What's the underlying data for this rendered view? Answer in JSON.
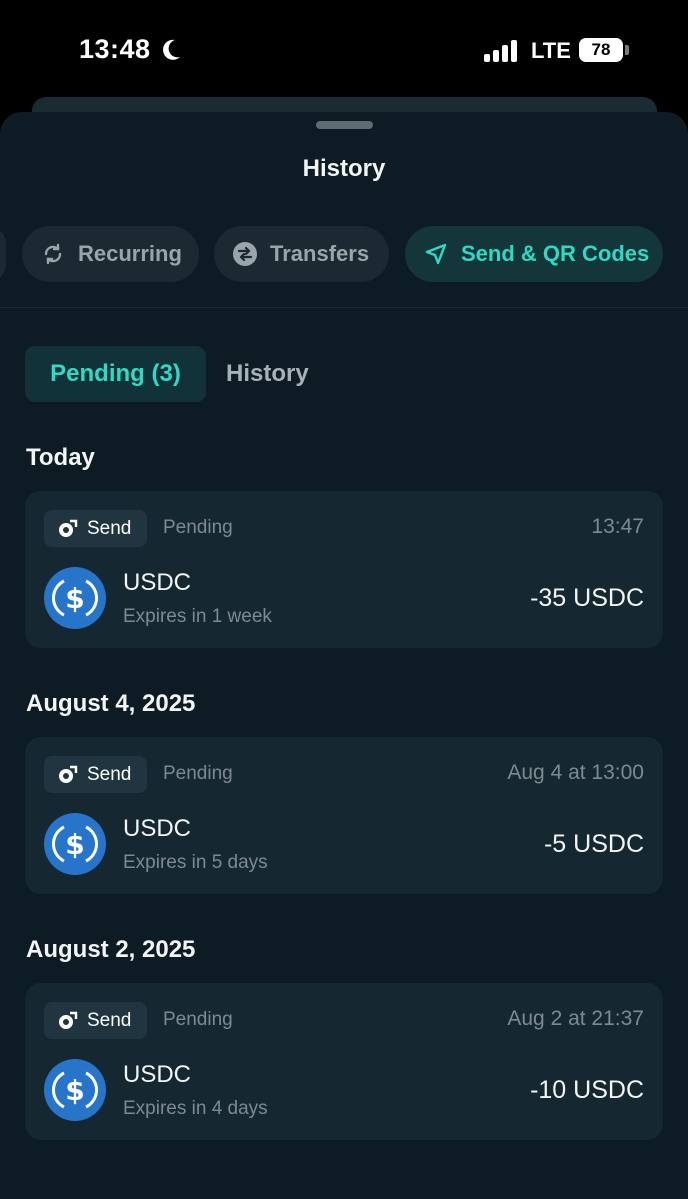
{
  "status_bar": {
    "time": "13:48",
    "network": "LTE",
    "battery": "78"
  },
  "sheet": {
    "title": "History"
  },
  "filters": [
    {
      "label": "Recurring",
      "icon": "recurring-icon",
      "active": false
    },
    {
      "label": "Transfers",
      "icon": "transfers-icon",
      "active": false
    },
    {
      "label": "Send & QR Codes",
      "icon": "send-arrow-icon",
      "active": true
    }
  ],
  "segments": {
    "pending": "Pending (3)",
    "history": "History"
  },
  "colors": {
    "accent": "#2fd9c4",
    "usdc": "#2775ca",
    "sheet_bg": "#0d1c24",
    "card_bg": "#152730"
  },
  "groups": [
    {
      "title": "Today",
      "items": [
        {
          "type": "Send",
          "status": "Pending",
          "time": "13:47",
          "asset": "USDC",
          "expires": "Expires in 1 week",
          "amount": "-35 USDC"
        }
      ]
    },
    {
      "title": "August 4, 2025",
      "items": [
        {
          "type": "Send",
          "status": "Pending",
          "time": "Aug 4 at 13:00",
          "asset": "USDC",
          "expires": "Expires in 5 days",
          "amount": "-5 USDC"
        }
      ]
    },
    {
      "title": "August 2, 2025",
      "items": [
        {
          "type": "Send",
          "status": "Pending",
          "time": "Aug 2 at 21:37",
          "asset": "USDC",
          "expires": "Expires in 4 days",
          "amount": "-10 USDC"
        }
      ]
    }
  ]
}
